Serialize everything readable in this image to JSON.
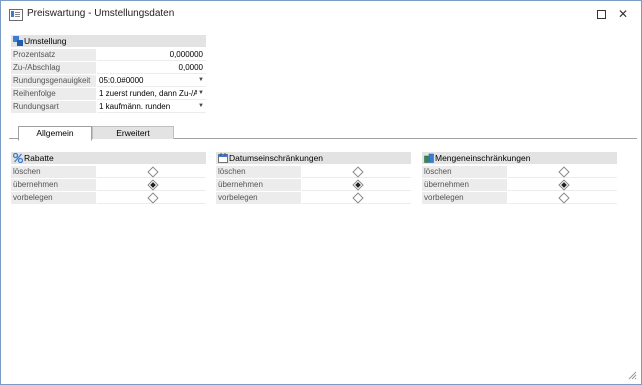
{
  "window": {
    "title": "Preiswartung - Umstellungsdaten"
  },
  "umstellung": {
    "header": "Umstellung",
    "rows": [
      {
        "label": "Prozentsatz",
        "value": "0,000000"
      },
      {
        "label": "Zu-/Abschlag",
        "value": "0,0000"
      },
      {
        "label": "Rundungsgenauigkeit",
        "value": "05:0.0#0000"
      },
      {
        "label": "Reihenfolge",
        "value": "1 zuerst runden, dann Zu-/A"
      },
      {
        "label": "Rundungsart",
        "value": "1 kaufmänn. runden"
      }
    ]
  },
  "tabs": [
    {
      "label": "Allgemein",
      "active": true
    },
    {
      "label": "Erweitert",
      "active": false
    }
  ],
  "groups": [
    {
      "header": "Rabatte",
      "icon": "percent-icon",
      "options": [
        {
          "label": "löschen",
          "checked": false
        },
        {
          "label": "übernehmen",
          "checked": true
        },
        {
          "label": "vorbelegen",
          "checked": false
        }
      ]
    },
    {
      "header": "Datumseinschränkungen",
      "icon": "calendar-icon",
      "options": [
        {
          "label": "löschen",
          "checked": false
        },
        {
          "label": "übernehmen",
          "checked": true
        },
        {
          "label": "vorbelegen",
          "checked": false
        }
      ]
    },
    {
      "header": "Mengeneinschränkungen",
      "icon": "quantity-icon",
      "options": [
        {
          "label": "löschen",
          "checked": false
        },
        {
          "label": "übernehmen",
          "checked": true
        },
        {
          "label": "vorbelegen",
          "checked": false
        }
      ]
    }
  ],
  "colors": {
    "accent": "#3a7bd5",
    "header_bg": "#e3e3e3",
    "label_bg": "#ececec"
  }
}
